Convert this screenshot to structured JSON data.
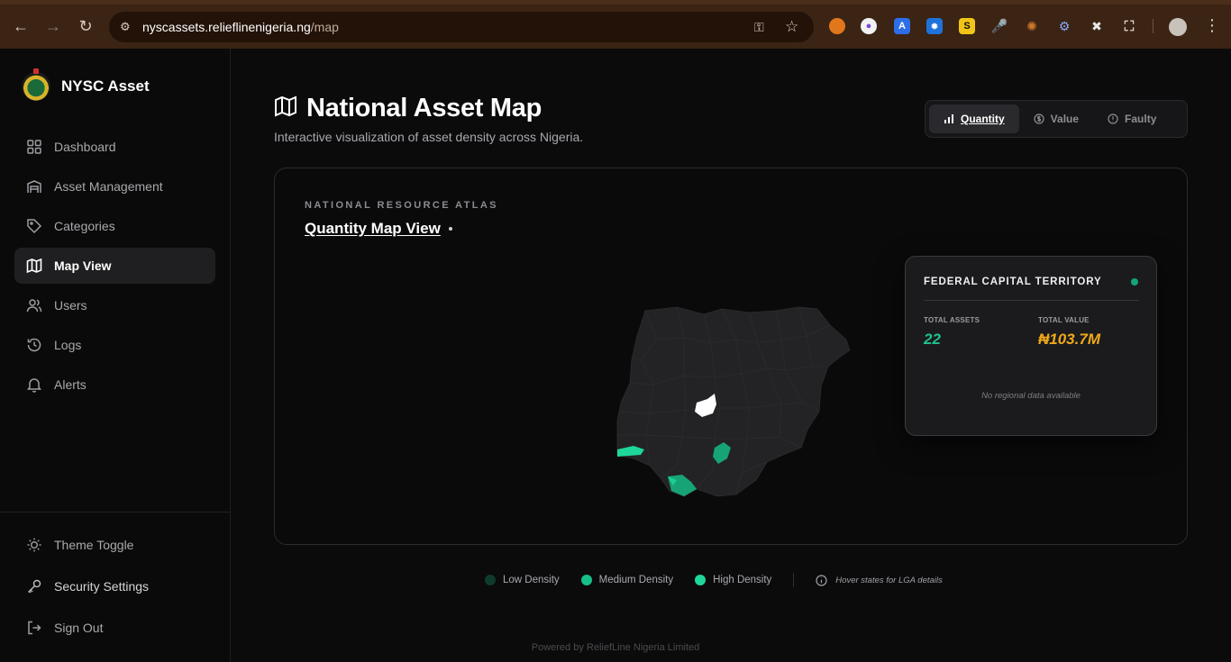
{
  "browser": {
    "url_host": "nyscassets.relieflinenigeria.ng",
    "url_path": "/map"
  },
  "sidebar": {
    "brand": "NYSC Asset",
    "items": [
      {
        "label": "Dashboard",
        "icon": "dashboard-grid-icon"
      },
      {
        "label": "Asset Management",
        "icon": "warehouse-icon"
      },
      {
        "label": "Categories",
        "icon": "tag-icon"
      },
      {
        "label": "Map View",
        "icon": "map-icon",
        "active": true
      },
      {
        "label": "Users",
        "icon": "users-icon"
      },
      {
        "label": "Logs",
        "icon": "history-icon"
      },
      {
        "label": "Alerts",
        "icon": "bell-icon"
      }
    ],
    "bottom": {
      "theme_toggle": "Theme Toggle",
      "security_settings": "Security Settings",
      "sign_out": "Sign Out"
    }
  },
  "header": {
    "title": "National Asset Map",
    "subtitle": "Interactive visualization of asset density across Nigeria.",
    "tabs": [
      {
        "label": "Quantity",
        "active": true
      },
      {
        "label": "Value"
      },
      {
        "label": "Faulty"
      }
    ]
  },
  "map_card": {
    "overline": "NATIONAL RESOURCE ATLAS",
    "title": "Quantity Map View"
  },
  "info_card": {
    "region": "FEDERAL CAPITAL TERRITORY",
    "total_assets_label": "TOTAL ASSETS",
    "total_assets_value": "22",
    "total_value_label": "TOTAL VALUE",
    "total_value_value": "₦103.7M",
    "note": "No regional data available"
  },
  "legend": {
    "low": "Low Density",
    "medium": "Medium Density",
    "high": "High Density",
    "hint": "Hover states for LGA details"
  },
  "colors": {
    "low": "#0e3b2c",
    "medium": "#16a476",
    "high": "#1ed69a",
    "accent_value": "#f0a81a"
  },
  "footer": "Powered by ReliefLine Nigeria Limited"
}
